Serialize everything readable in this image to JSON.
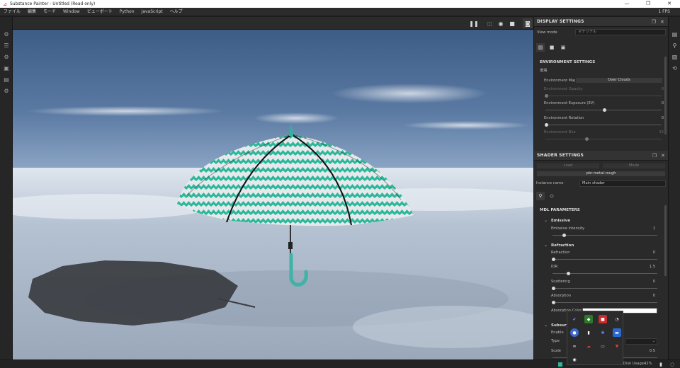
{
  "titlebar": {
    "title": "Substance Painter - Untitled (Read only)",
    "minimize": "—",
    "maximize": "❐",
    "close": "✕"
  },
  "menubar": {
    "items": [
      "ファイル",
      "編集",
      "モード",
      "Window",
      "ビューポート",
      "Python",
      "JavaScript",
      "ヘルプ"
    ],
    "fps": "1 FPS"
  },
  "display_settings": {
    "title": "DISPLAY SETTINGS",
    "view_mode_label": "View mode",
    "view_mode_value": "マテリアル",
    "environment": {
      "title": "ENVIRONMENT SETTINGS",
      "subtitle": "環境",
      "env_map_label": "Environment Map",
      "env_map_value": "Over Clouds",
      "opacity_label": "Environment Opacity",
      "opacity_value": "0",
      "exposure_label": "Environment Exposure (EV)",
      "exposure_value": "0",
      "rotation_label": "Environment Rotation",
      "rotation_value": "0",
      "blur_label": "Environment Blur",
      "blur_value": "15"
    }
  },
  "shader_settings": {
    "title": "SHADER SETTINGS",
    "btn_left": "Load",
    "btn_right": "Mode",
    "shader_name": "pbr-metal-rough",
    "instance_name_label": "Instance name",
    "instance_name_value": "Main shader",
    "mdl_title": "MDL PARAMETERS",
    "emissive": {
      "title": "Emissive",
      "intensity_label": "Emissive intensity",
      "intensity_value": "1"
    },
    "refraction": {
      "title": "Refraction",
      "refraction_label": "Refraction",
      "refraction_value": "0",
      "ior_label": "IOR",
      "ior_value": "1.5",
      "scattering_label": "Scattering",
      "scattering_value": "0",
      "absorption_label": "Absorption",
      "absorption_value": "0",
      "absorption_color_label": "Absorption Color"
    },
    "subsurface": {
      "title": "Subsurf",
      "enable_label": "Enable",
      "type_label": "Type",
      "scale_label": "Scale",
      "scale_value": "0.5"
    }
  },
  "statusbar": {
    "disk_usage": "Disk Usage:",
    "disk_value": "42%"
  },
  "colors": {
    "canopy_teal": "#2bb89a",
    "canopy_white": "#e4e6ea",
    "handle_teal": "#3fb3a6",
    "panel_bg": "#2a2a2a",
    "accent_red": "#d02020"
  }
}
